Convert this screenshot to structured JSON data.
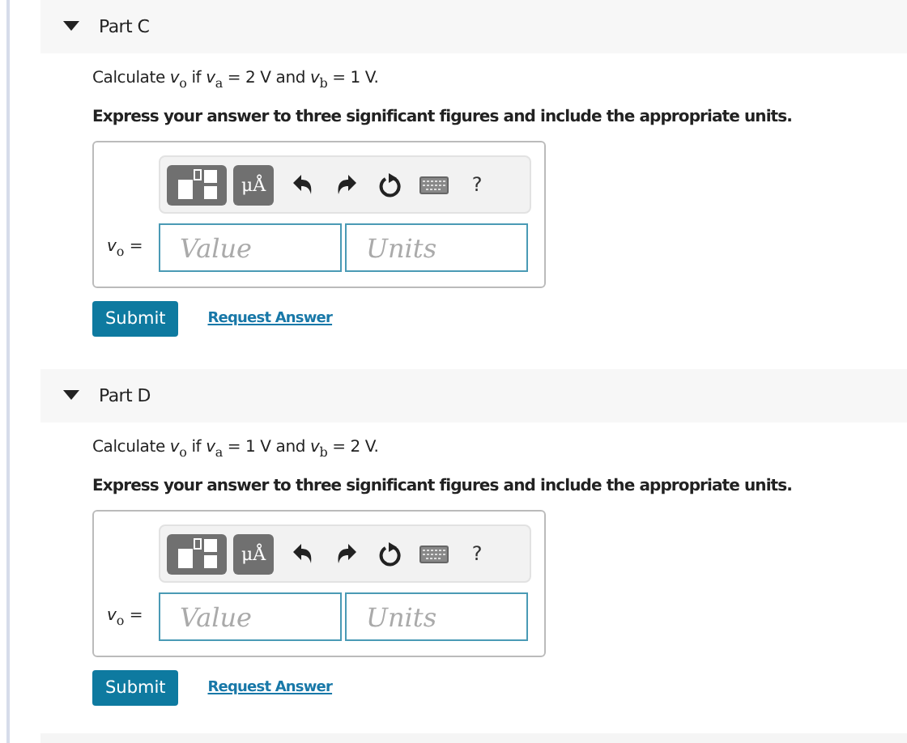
{
  "parts": [
    {
      "title": "Part C",
      "expanded": true,
      "question": "Calculate *v*$_{o}$ if *v*$_{a}$ = 2 V and *v*$_{b}$ = 1 V.",
      "instruction": "Express your answer to three significant figures and include the appropriate units.",
      "toolbar": {
        "units_button": "μÅ",
        "help": "?"
      },
      "answer_label": "*v*$_{o}$ =",
      "value_placeholder": "Value",
      "units_placeholder": "Units",
      "submit": "Submit",
      "request": "Request Answer"
    },
    {
      "title": "Part D",
      "expanded": true,
      "question": "Calculate *v*$_{o}$ if *v*$_{a}$ = 1 V and *v*$_{b}$ = 2 V.",
      "instruction": "Express your answer to three significant figures and include the appropriate units.",
      "toolbar": {
        "units_button": "μÅ",
        "help": "?"
      },
      "answer_label": "*v*$_{o}$ =",
      "value_placeholder": "Value",
      "units_placeholder": "Units",
      "submit": "Submit",
      "request": "Request Answer"
    }
  ]
}
